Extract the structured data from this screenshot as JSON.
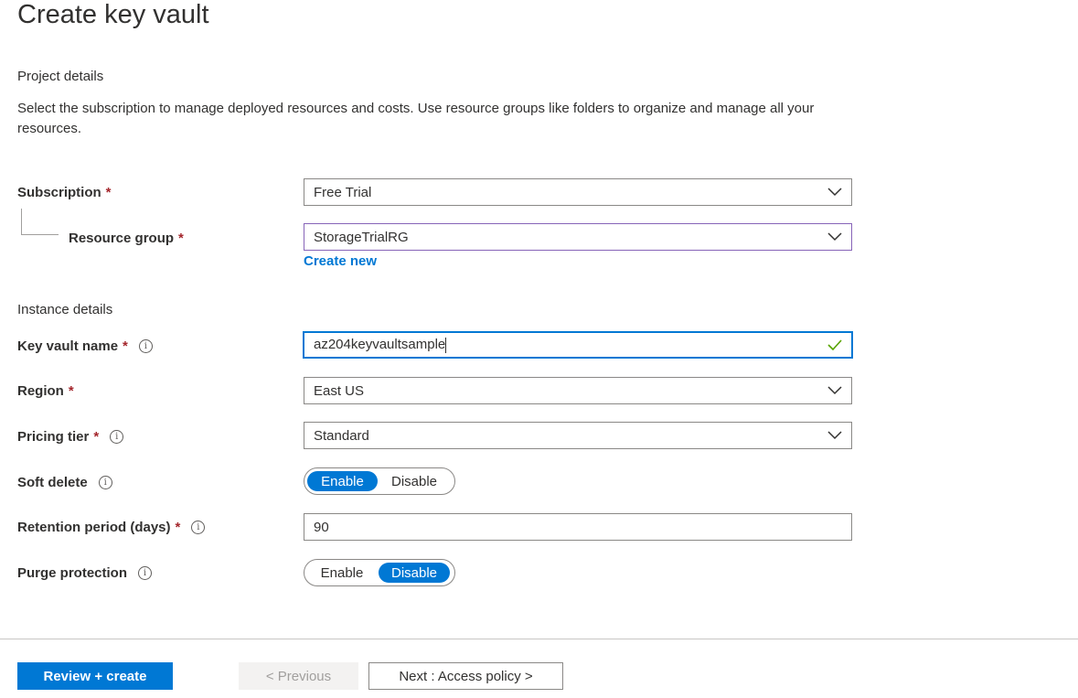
{
  "page": {
    "title": "Create key vault"
  },
  "project": {
    "label": "Project details",
    "description": "Select the subscription to manage deployed resources and costs. Use resource groups like folders to organize and manage all your resources.",
    "subscription": {
      "label": "Subscription",
      "required_mark": "*",
      "value": "Free Trial"
    },
    "resource_group": {
      "label": "Resource group",
      "required_mark": "*",
      "value": "StorageTrialRG",
      "create_new": "Create new"
    }
  },
  "instance": {
    "label": "Instance details",
    "key_vault_name": {
      "label": "Key vault name",
      "required_mark": "*",
      "info": "i",
      "value": "az204keyvaultsample"
    },
    "region": {
      "label": "Region",
      "required_mark": "*",
      "value": "East US"
    },
    "pricing_tier": {
      "label": "Pricing tier",
      "required_mark": "*",
      "info": "i",
      "value": "Standard"
    },
    "soft_delete": {
      "label": "Soft delete",
      "info": "i",
      "enable": "Enable",
      "disable": "Disable",
      "selected": "Enable"
    },
    "retention": {
      "label": "Retention period (days)",
      "required_mark": "*",
      "info": "i",
      "value": "90"
    },
    "purge_protection": {
      "label": "Purge protection",
      "info": "i",
      "enable": "Enable",
      "disable": "Disable",
      "selected": "Disable"
    }
  },
  "footer": {
    "review_create": "Review + create",
    "previous": "< Previous",
    "next": "Next : Access policy >"
  },
  "colors": {
    "accent": "#0078d4",
    "required": "#a4262c",
    "valid": "#57a300"
  },
  "icons": {
    "dropdown": "chevron-down-icon",
    "valid": "checkmark-icon",
    "info": "info-icon"
  }
}
